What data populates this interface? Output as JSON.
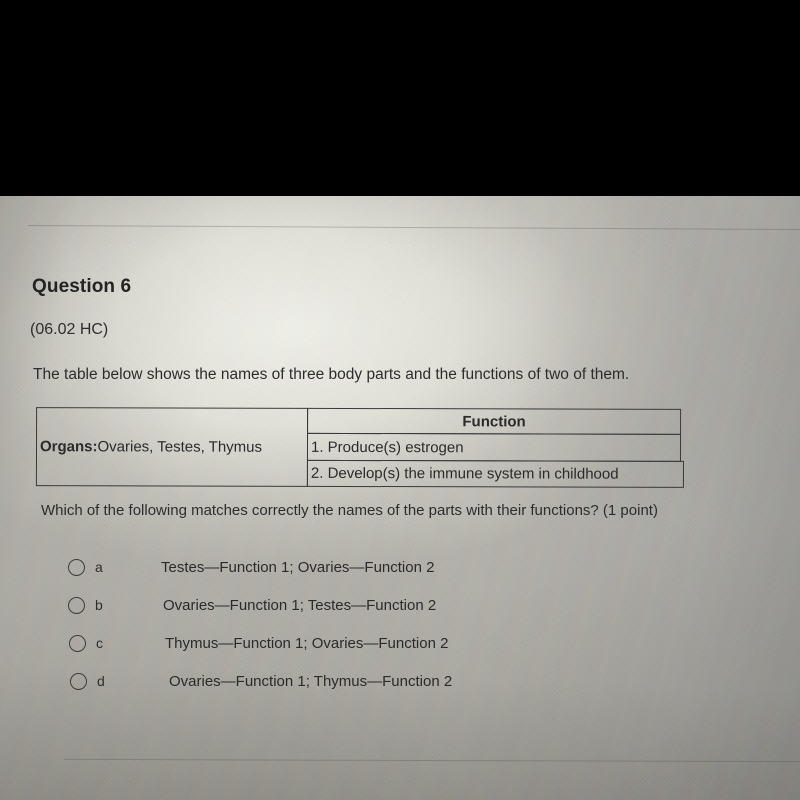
{
  "question": {
    "title": "Question 6",
    "code": "(06.02 HC)",
    "stem": "The table below shows the names of three body parts and the functions of two of them.",
    "prompt": "Which of the following matches correctly the names of the parts with their functions? (1 point)"
  },
  "table": {
    "organs_label": "Organs:",
    "organs_value": " Ovaries, Testes, Thymus",
    "function_header": "Function",
    "function_1": "1. Produce(s) estrogen",
    "function_2": "2. Develop(s) the immune system in childhood"
  },
  "options": [
    {
      "letter": "a",
      "text": "Testes—Function 1; Ovaries—Function 2",
      "selected": false
    },
    {
      "letter": "b",
      "text": "Ovaries—Function 1; Testes—Function 2",
      "selected": false
    },
    {
      "letter": "c",
      "text": "Thymus—Function 1; Ovaries—Function 2",
      "selected": false
    },
    {
      "letter": "d",
      "text": "Ovaries—Function 1; Thymus—Function 2",
      "selected": false
    }
  ],
  "colors": {
    "text": "#2b2b2b",
    "table_border": "#3a3a3a",
    "letterbox": "#000000",
    "paper_light": "#f3f3ec",
    "paper_shadow": "#6e6e70"
  }
}
